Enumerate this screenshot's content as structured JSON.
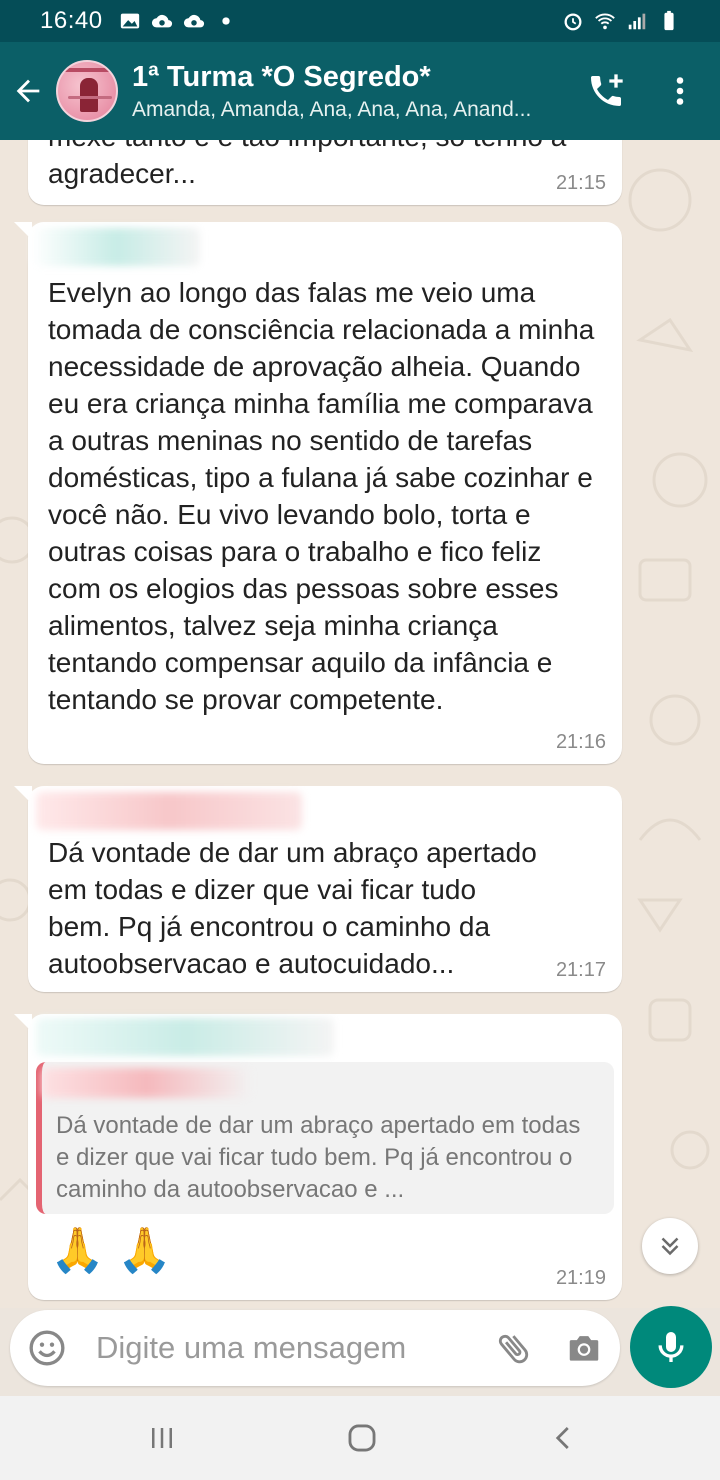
{
  "status_bar": {
    "time": "16:40",
    "left_icons": [
      "gallery-icon",
      "cloud-sync-icon",
      "cloud-sync-icon",
      "dot-icon"
    ],
    "right_icons": [
      "alarm-icon",
      "wifi-icon",
      "signal-icon",
      "battery-icon"
    ]
  },
  "header": {
    "title": "1ª Turma *O Segredo*",
    "subtitle": "Amanda, Amanda, Ana, Ana, Ana, Anand...",
    "actions": [
      "add-call-icon",
      "more-options-icon"
    ]
  },
  "messages": [
    {
      "partial_top": "mexe tanto e é tão importante, só tenho a",
      "text": "agradecer...",
      "time": "21:15"
    },
    {
      "text": "Evelyn ao longo das falas me veio uma tomada de consciência relacionada a minha necessidade de aprovação alheia. Quando eu era criança minha família me comparava a outras meninas no sentido de tarefas domésticas, tipo a fulana já sabe cozinhar e você não. Eu vivo levando bolo, torta e outras coisas para o trabalho e fico feliz com os elogios das pessoas sobre esses alimentos, talvez seja minha criança tentando compensar aquilo da infância e tentando se provar competente.",
      "time": "21:16"
    },
    {
      "text": "Dá vontade de dar um abraço apertado em todas e dizer que vai ficar tudo bem. Pq já encontrou o caminho da autoobservacao e autocuidado...",
      "time": "21:17"
    },
    {
      "quote": "Dá vontade de dar um abraço apertado em todas e dizer que vai ficar tudo bem. Pq já encontrou o caminho da autoobservacao e ...",
      "text": "🙏 🙏",
      "time": "21:19"
    }
  ],
  "composer": {
    "placeholder": "Digite uma mensagem"
  },
  "colors": {
    "header": "#0b5f67",
    "status_bar": "#054d57",
    "accent_mic": "#00897b",
    "quote_bar": "#e46472"
  }
}
